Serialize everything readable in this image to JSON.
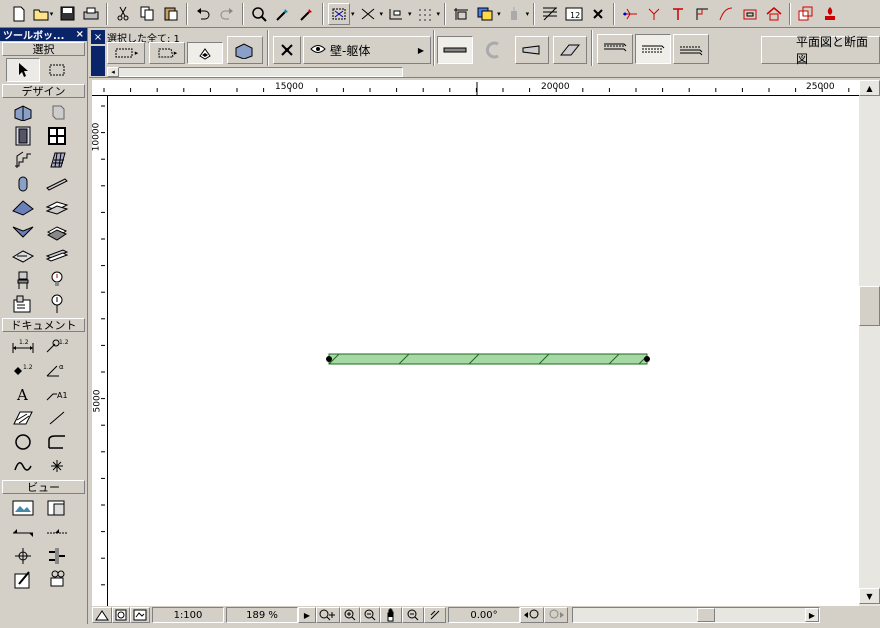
{
  "toolbar": {
    "icons": [
      "new-icon",
      "open-icon",
      "save-icon",
      "print-icon",
      "cut-icon",
      "copy-icon",
      "paste-icon",
      "undo-icon",
      "redo-icon",
      "find-select-icon",
      "pick-up-icon",
      "inject-icon",
      "marquee-icon",
      "snap-guide-icon",
      "coordinate-icon",
      "grid-snap-icon",
      "layer-icon",
      "layer-combo-icon",
      "elevation-icon",
      "dimension-tool-icon",
      "delete-icon",
      "trim-icon",
      "adjust-icon",
      "intersect-icon",
      "fillet-icon",
      "offset-icon",
      "rectangle-icon",
      "home-icon",
      "3d-window-icon",
      "render-icon"
    ]
  },
  "toolbox": {
    "title": "ツールボッ...",
    "close": "×",
    "sections": {
      "select": "選択",
      "design": "デザイン",
      "document": "ドキュメント",
      "view": "ビュー"
    }
  },
  "infobox": {
    "close": "×",
    "selection_text": "選択した全て: 1",
    "layer_label": "壁-躯体",
    "view_button": "平面図と断面図"
  },
  "ruler": {
    "top_labels": [
      "15000",
      "20000",
      "25000"
    ],
    "left_labels": [
      "10000",
      "5000"
    ]
  },
  "status": {
    "scale": "1:100",
    "zoom": "189 %",
    "angle": "0.00°"
  },
  "colors": {
    "wall_fill": "#a6d8a6",
    "wall_stroke": "#1c6a1c",
    "title_bar": "#0a246a"
  }
}
